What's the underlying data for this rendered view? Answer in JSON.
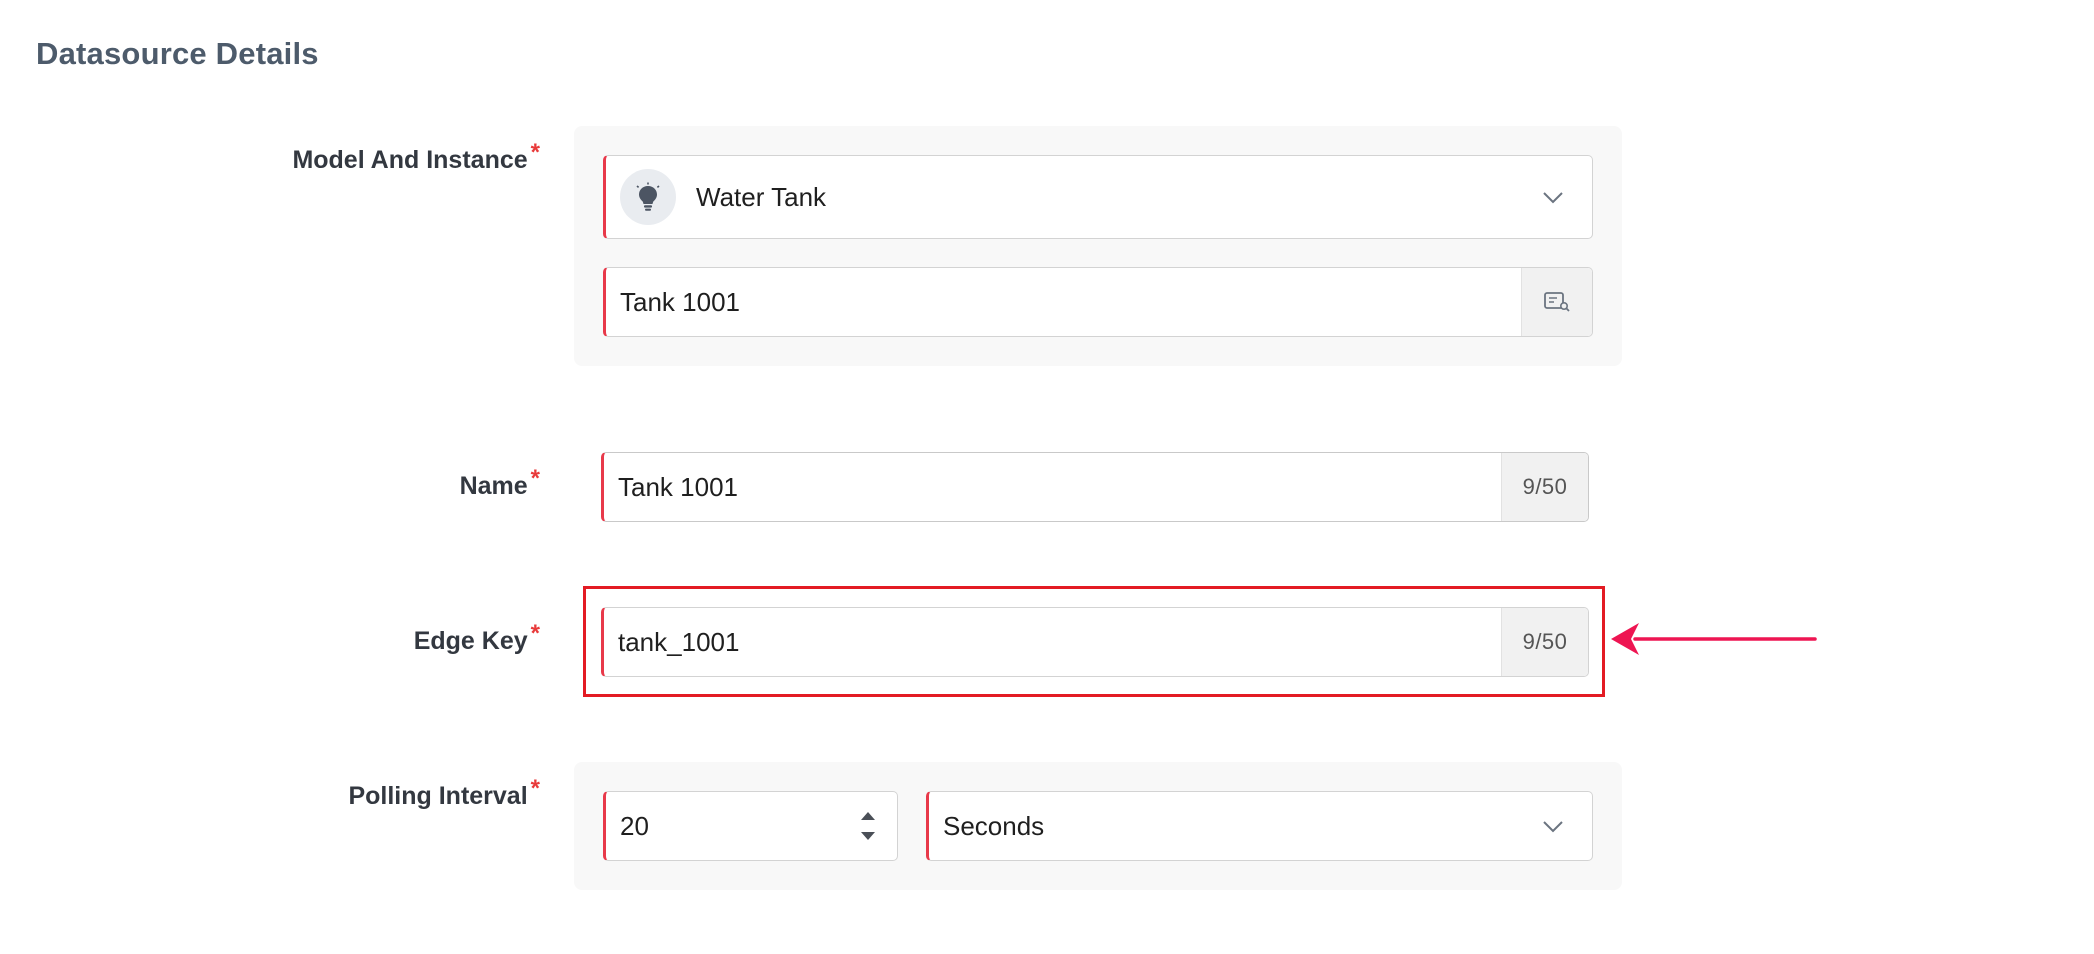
{
  "section": {
    "title": "Datasource Details"
  },
  "fields": {
    "model_instance": {
      "label": "Model And Instance",
      "required_mark": "*",
      "model_value": "Water Tank",
      "model_icon": "lightbulb-icon",
      "instance_value": "Tank 1001",
      "instance_addon_icon": "search-list-icon"
    },
    "name": {
      "label": "Name",
      "required_mark": "*",
      "value": "Tank 1001",
      "counter": "9/50"
    },
    "edge_key": {
      "label": "Edge Key",
      "required_mark": "*",
      "value": "tank_1001",
      "counter": "9/50"
    },
    "polling_interval": {
      "label": "Polling Interval",
      "required_mark": "*",
      "value": "20",
      "unit": "Seconds"
    }
  },
  "colors": {
    "required": "#e83a3a",
    "highlight": "#e31b23",
    "arrow": "#ee1552",
    "input_accent": "#e8394a"
  }
}
